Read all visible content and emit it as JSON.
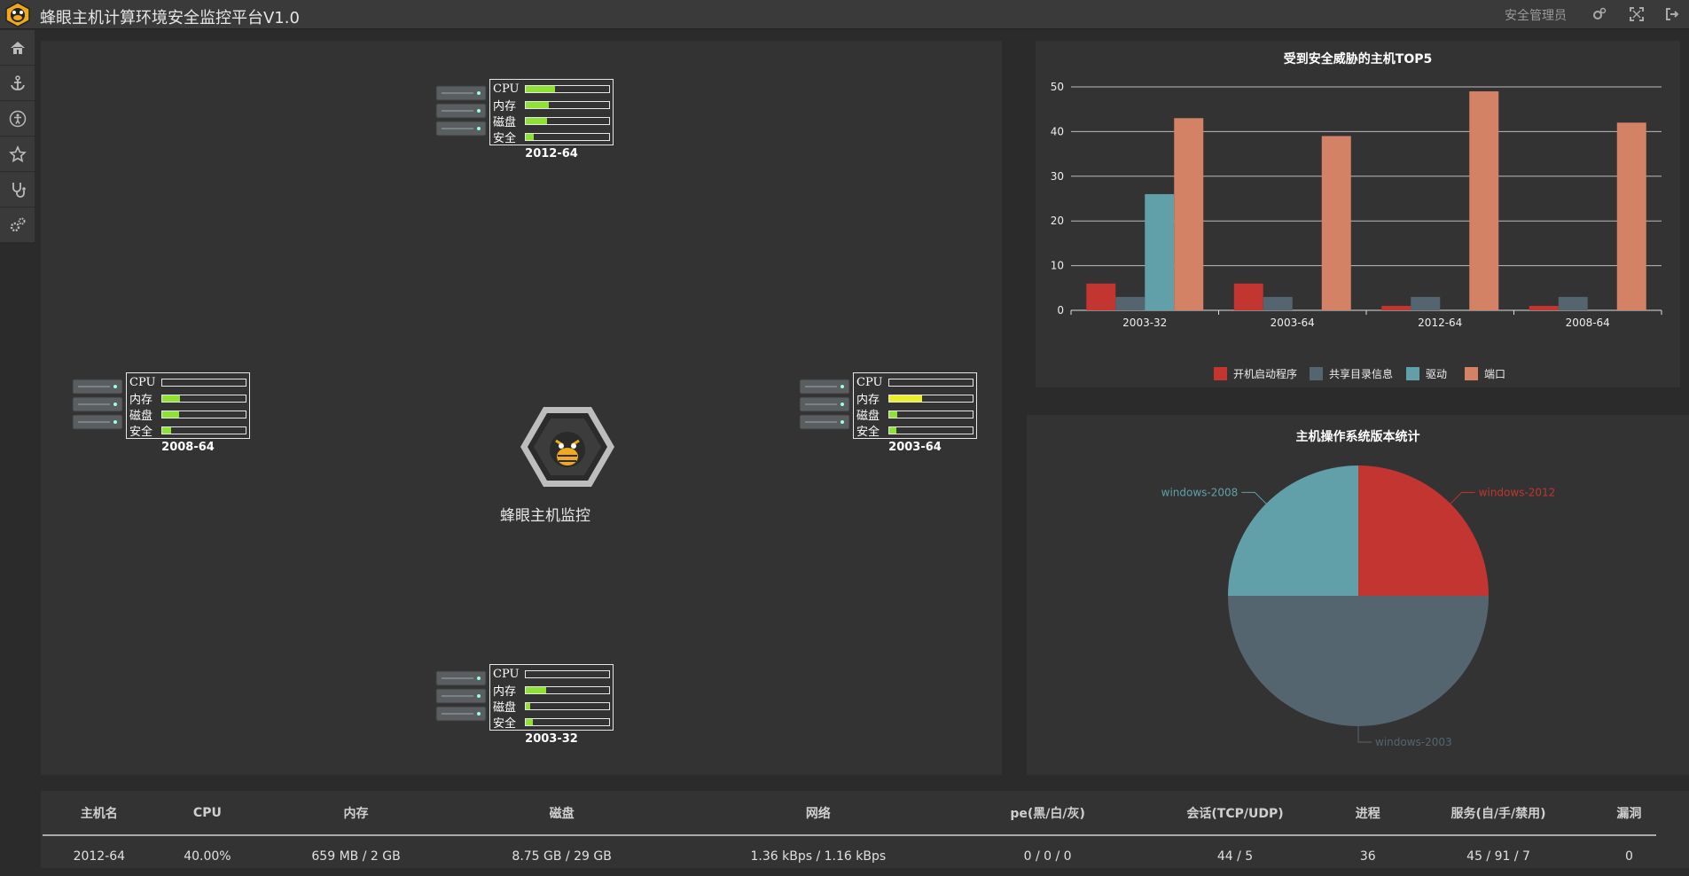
{
  "app": {
    "title": "蜂眼主机计算环境安全监控平台V1.0",
    "user": "安全管理员",
    "top_icons": [
      "gears-icon",
      "fullscreen-icon",
      "logout-icon"
    ]
  },
  "sidebar": {
    "items": [
      {
        "icon": "home-icon"
      },
      {
        "icon": "anchor-icon"
      },
      {
        "icon": "accessibility-icon"
      },
      {
        "icon": "star-icon"
      },
      {
        "icon": "stethoscope-icon"
      },
      {
        "icon": "settings-icon"
      }
    ]
  },
  "topology": {
    "center_label": "蜂眼主机监控",
    "stat_labels": [
      "CPU",
      "内存",
      "磁盘",
      "安全"
    ],
    "hosts": [
      {
        "name": "2012-64",
        "stats": [
          0.35,
          0.28,
          0.26,
          0.1
        ],
        "fill_colors": [
          "#8fe233",
          "#8fe233",
          "#8fe233",
          "#8fe233"
        ]
      },
      {
        "name": "2008-64",
        "stats": [
          0.0,
          0.22,
          0.2,
          0.11
        ],
        "fill_colors": [
          "#8fe233",
          "#8fe233",
          "#8fe233",
          "#8fe233"
        ]
      },
      {
        "name": "2003-64",
        "stats": [
          0.0,
          0.4,
          0.1,
          0.09
        ],
        "fill_colors": [
          "#8fe233",
          "#e9f02b",
          "#8fe233",
          "#8fe233"
        ]
      },
      {
        "name": "2003-32",
        "stats": [
          0.0,
          0.25,
          0.06,
          0.09
        ],
        "fill_colors": [
          "#8fe233",
          "#8fe233",
          "#8fe233",
          "#8fe233"
        ]
      }
    ]
  },
  "chart_data": [
    {
      "type": "bar",
      "title": "受到安全威胁的主机TOP5",
      "categories": [
        "2003-32",
        "2003-64",
        "2012-64",
        "2008-64"
      ],
      "ylim": [
        0,
        50
      ],
      "yticks": [
        0,
        10,
        20,
        30,
        40,
        50
      ],
      "grid": true,
      "legend_position": "bottom",
      "series": [
        {
          "name": "开机启动程序",
          "color": "#c23531",
          "values": [
            6,
            6,
            1,
            1
          ]
        },
        {
          "name": "共享目录信息",
          "color": "#546570",
          "values": [
            3,
            3,
            3,
            3
          ]
        },
        {
          "name": "驱动",
          "color": "#61a0a8",
          "values": [
            26,
            0,
            0,
            0
          ]
        },
        {
          "name": "端口",
          "color": "#d48265",
          "values": [
            43,
            39,
            49,
            42
          ]
        }
      ]
    },
    {
      "type": "pie",
      "title": "主机操作系统版本统计",
      "slices": [
        {
          "label": "windows-2012",
          "value": 1,
          "color": "#c23531"
        },
        {
          "label": "windows-2003",
          "value": 2,
          "color": "#546570"
        },
        {
          "label": "windows-2008",
          "value": 1,
          "color": "#61a0a8"
        }
      ]
    }
  ],
  "table": {
    "headers": [
      "主机名",
      "CPU",
      "内存",
      "磁盘",
      "网络",
      "pe(黑/白/灰)",
      "会话(TCP/UDP)",
      "进程",
      "服务(自/手/禁用)",
      "漏洞"
    ],
    "rows": [
      [
        "2012-64",
        "40.00%",
        "659 MB / 2 GB",
        "8.75 GB / 29 GB",
        "1.36 kBps / 1.16 kBps",
        "0 / 0 / 0",
        "44 / 5",
        "36",
        "45 / 91 / 7",
        "0"
      ]
    ]
  }
}
